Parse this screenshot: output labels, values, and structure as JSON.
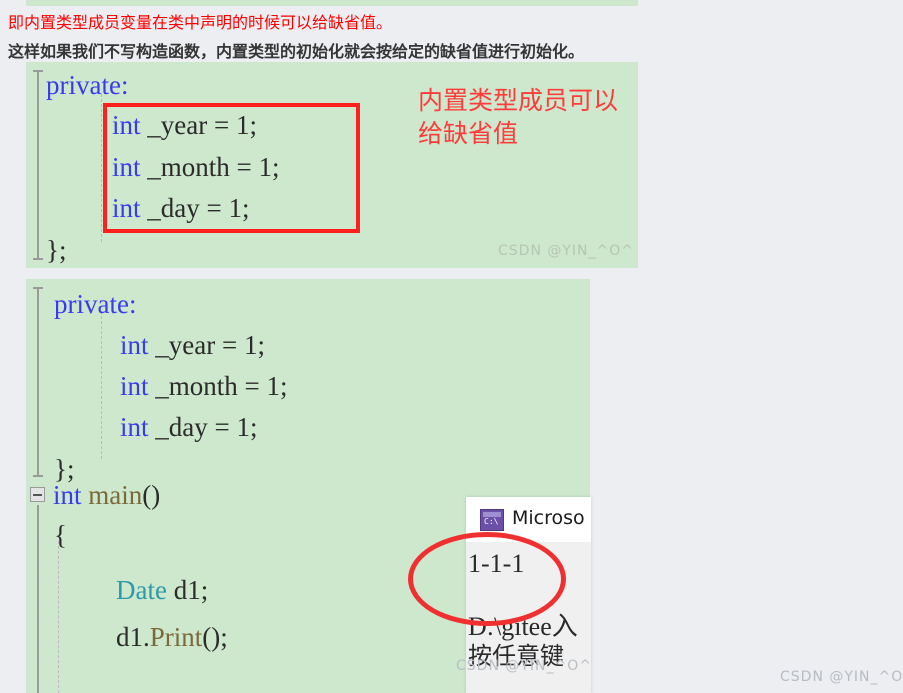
{
  "page": {
    "background_color": "#edeef2",
    "top_partial_text": "};"
  },
  "prose": {
    "line_red": "即内置类型成员变量在类中声明的时候可以给缺省值。",
    "line_bold": "这样如果我们不写构造函数，内置类型的初始化就会按给定的缺省值进行初始化。",
    "red_color": "#ff0000",
    "bold_color": "#353535"
  },
  "code_block_1": {
    "background_color": "#cde8cd",
    "lines": {
      "private": "private:",
      "year_kw": "int",
      "year_rest": " _year = 1;",
      "month_kw": "int",
      "month_rest": " _month = 1;",
      "day_kw": "int",
      "day_rest": " _day = 1;",
      "close": "};"
    },
    "annotation": {
      "note_text": "内置类型成员可以\n给缺省值",
      "note_color": "#ff3b3b",
      "box_color": "#ff2020"
    },
    "watermark": "CSDN @YIN_^O^"
  },
  "code_block_2": {
    "background_color": "#cde8cd",
    "lines": {
      "private": "private:",
      "year_kw": "int",
      "year_rest": " _year = 1;",
      "month_kw": "int",
      "month_rest": " _month = 1;",
      "day_kw": "int",
      "day_rest": " _day = 1;",
      "close": "};",
      "main_kw": "int",
      "main_fn": " main",
      "main_parens": "()",
      "brace_open": "{",
      "date_type": "Date",
      "date_var": " d1;",
      "call_obj": "d1.",
      "call_fn": "Print",
      "call_rest": "();"
    }
  },
  "console": {
    "title": "Microso",
    "icon": "cmd-icon",
    "output_line": "1-1-1",
    "path_line": "D:\\gitee入",
    "prompt_line": "按任意键"
  },
  "ellipse_annotation": {
    "color": "#f03030"
  },
  "watermarks": {
    "console_overlay": "CSDN @YIN_^O^",
    "page_corner": "CSDN @YIN_^O^"
  }
}
